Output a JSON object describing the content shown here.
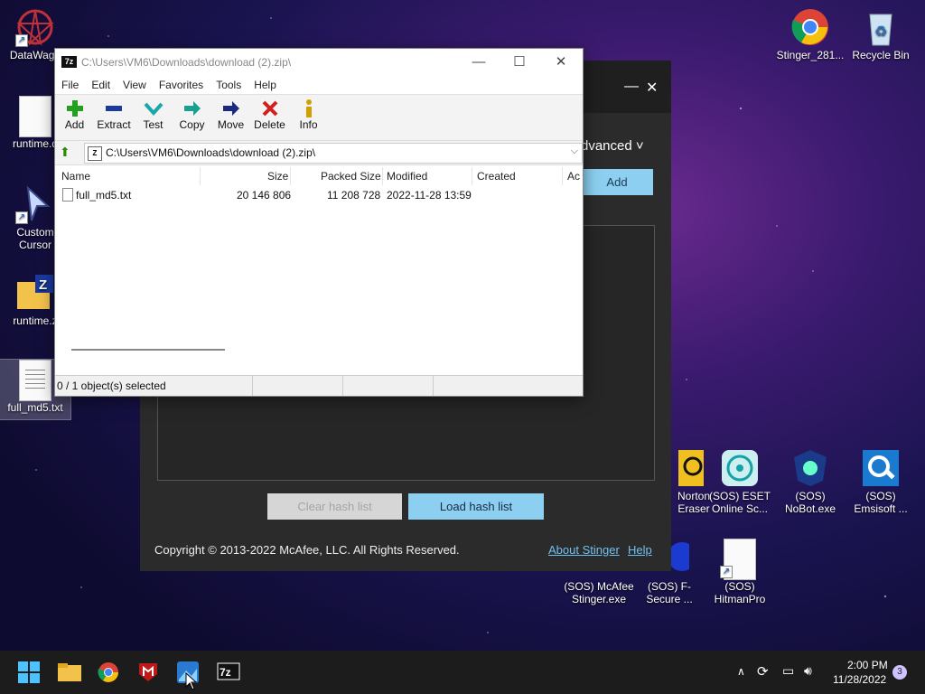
{
  "desktop_icons": [
    {
      "label": "DataWago"
    },
    {
      "label": "runtime.d"
    },
    {
      "label": "Custom Cursor"
    },
    {
      "label": "runtime.z"
    },
    {
      "label": "full_md5.txt"
    },
    {
      "label": "Stinger_281..."
    },
    {
      "label": "Recycle Bin"
    },
    {
      "label": "Norton Eraser"
    },
    {
      "label": "(SOS) ESET Online Sc..."
    },
    {
      "label": "(SOS) NoBot.exe"
    },
    {
      "label": "(SOS) Emsisoft ..."
    },
    {
      "label": "(SOS) McAfee Stinger.exe"
    },
    {
      "label": "(SOS) F-Secure ..."
    },
    {
      "label": "(SOS) HitmanPro"
    }
  ],
  "stinger": {
    "advanced_label": "dvanced ˅",
    "add_label": "Add",
    "clear_label": "Clear hash list",
    "load_label": "Load hash list",
    "copyright": "Copyright © 2013-2022 McAfee, LLC. All Rights Reserved.",
    "about_label": "About Stinger",
    "help_label": "Help"
  },
  "zip": {
    "title": "C:\\Users\\VM6\\Downloads\\download (2).zip\\",
    "menu": [
      "File",
      "Edit",
      "View",
      "Favorites",
      "Tools",
      "Help"
    ],
    "toolbar": [
      {
        "label": "Add",
        "icon": "plus-icon"
      },
      {
        "label": "Extract",
        "icon": "minus-icon"
      },
      {
        "label": "Test",
        "icon": "check-icon"
      },
      {
        "label": "Copy",
        "icon": "copy-arrow-icon"
      },
      {
        "label": "Move",
        "icon": "move-arrow-icon"
      },
      {
        "label": "Delete",
        "icon": "delete-x-icon"
      },
      {
        "label": "Info",
        "icon": "info-icon"
      }
    ],
    "address": "C:\\Users\\VM6\\Downloads\\download (2).zip\\",
    "columns": [
      "Name",
      "Size",
      "Packed Size",
      "Modified",
      "Created",
      "Ac"
    ],
    "rows": [
      {
        "name": "full_md5.txt",
        "size": "20 146 806",
        "packed": "11 208 728",
        "modified": "2022-11-28 13:59",
        "created": ""
      }
    ],
    "status": "0 / 1 object(s) selected"
  },
  "tray": {
    "time": "2:00 PM",
    "date": "11/28/2022",
    "badge": "3"
  }
}
